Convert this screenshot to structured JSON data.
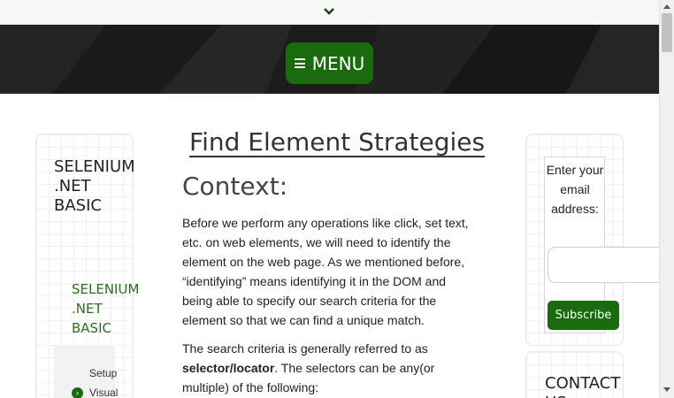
{
  "header": {
    "menu_label": "MENU",
    "menu_icon": "hamburger-icon",
    "top_icon": "chevron-down-icon"
  },
  "left_sidebar": {
    "title": "SELENIUM\n.NET\nBASIC",
    "subtitle": "SELENIUM\n.NET\nBASIC",
    "items": [
      {
        "label": "Setup"
      },
      {
        "label": "Visual",
        "icon": "chevron-right-circle-icon"
      }
    ]
  },
  "main": {
    "title": "Find Element Strategies",
    "section_heading": "Context:",
    "paragraph1": "Before we perform any operations like click, set text, etc. on web elements, we will need to identify the element on the web page.  As we mentioned before, “identifying” means identifying it in the DOM and being able to specify our search criteria for the element so that we can find a unique match.",
    "paragraph2_before": "The search criteria is generally referred to as ",
    "paragraph2_bold": "selector/locator",
    "paragraph2_after": ". The selectors can be any(or multiple) of the following:"
  },
  "right_sidebar": {
    "subscribe_prompt": "Enter your email address:",
    "email_placeholder": "",
    "subscribe_label": "Subscribe",
    "contact_heading": "CONTACT\nUS"
  },
  "colors": {
    "accent_green": "#1a6b0e",
    "header_bg": "#1c1c1c"
  }
}
